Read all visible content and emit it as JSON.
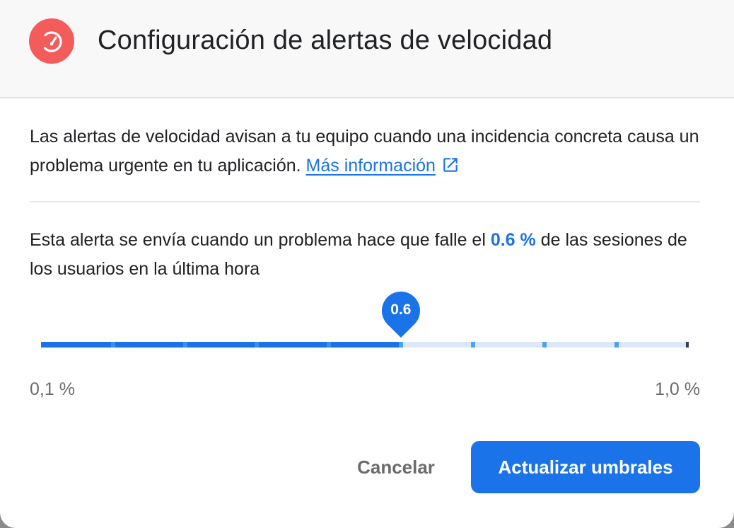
{
  "dialog": {
    "title": "Configuración de alertas de velocidad",
    "header_icon": "speedometer-icon",
    "accent_color": "#1a73e8",
    "icon_bg_color": "#f45b5b"
  },
  "intro": {
    "text": "Las alertas de velocidad avisan a tu equipo cuando una incidencia concreta causa un problema urgente en tu aplicación.",
    "link_label": "Más información",
    "link_icon": "open-in-new-icon"
  },
  "threshold": {
    "text_before": "Esta alerta se envía cuando un problema hace que falle el",
    "value_label": "0.6 %",
    "text_after": "de las sesiones de los usuarios en la última hora"
  },
  "slider": {
    "value": 0.6,
    "min": 0.1,
    "max": 1.0,
    "step": 0.1,
    "thumb_label": "0.6",
    "min_label": "0,1 %",
    "max_label": "1,0 %"
  },
  "actions": {
    "cancel_label": "Cancelar",
    "update_label": "Actualizar umbrales"
  }
}
